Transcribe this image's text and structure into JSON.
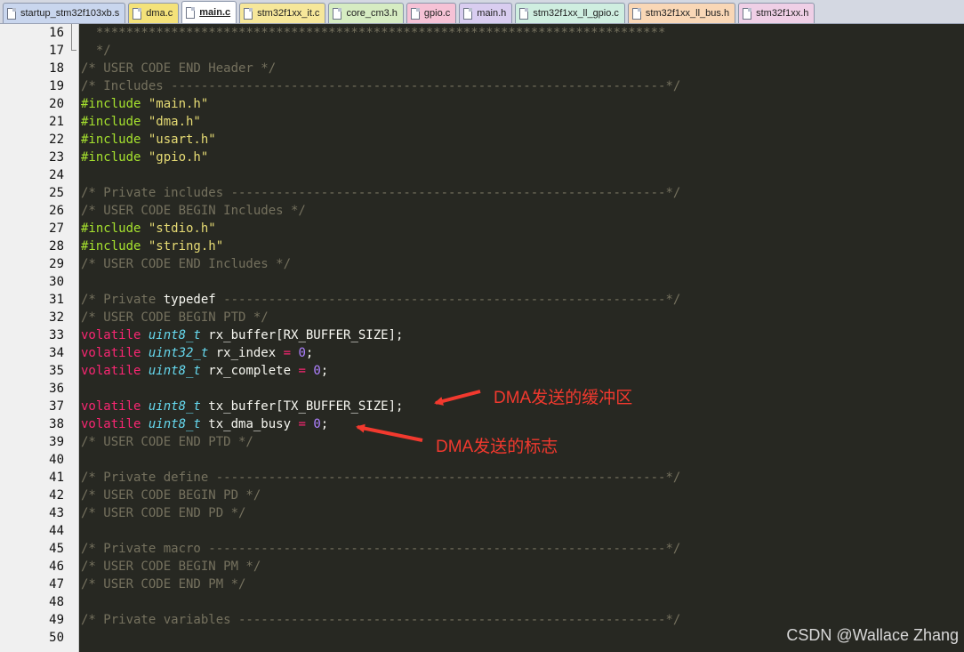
{
  "tabs": [
    {
      "label": "startup_stm32f103xb.s",
      "color": "#c9d6ee"
    },
    {
      "label": "dma.c",
      "color": "#f4e27a"
    },
    {
      "label": "main.c",
      "color": "#ffffff",
      "active": true
    },
    {
      "label": "stm32f1xx_it.c",
      "color": "#f6e79a"
    },
    {
      "label": "core_cm3.h",
      "color": "#d6ecc2"
    },
    {
      "label": "gpio.c",
      "color": "#f6c2d6"
    },
    {
      "label": "main.h",
      "color": "#d9cdf0"
    },
    {
      "label": "stm32f1xx_ll_gpio.c",
      "color": "#cfeee0"
    },
    {
      "label": "stm32f1xx_ll_bus.h",
      "color": "#f9d7b6"
    },
    {
      "label": "stm32f1xx.h",
      "color": "#efcfe6"
    }
  ],
  "code": [
    {
      "n": "16",
      "t": [
        [
          "cm",
          "  ****************************************************************************"
        ]
      ]
    },
    {
      "n": "17",
      "t": [
        [
          "cm",
          "  */"
        ]
      ]
    },
    {
      "n": "18",
      "t": [
        [
          "cm",
          "/* USER CODE END Header */"
        ]
      ]
    },
    {
      "n": "19",
      "t": [
        [
          "cm",
          "/* Includes ------------------------------------------------------------------*/"
        ]
      ]
    },
    {
      "n": "20",
      "t": [
        [
          "pp",
          "#include "
        ],
        [
          "str",
          "\"main.h\""
        ]
      ]
    },
    {
      "n": "21",
      "t": [
        [
          "pp",
          "#include "
        ],
        [
          "str",
          "\"dma.h\""
        ]
      ]
    },
    {
      "n": "22",
      "t": [
        [
          "pp",
          "#include "
        ],
        [
          "str",
          "\"usart.h\""
        ]
      ]
    },
    {
      "n": "23",
      "t": [
        [
          "pp",
          "#include "
        ],
        [
          "str",
          "\"gpio.h\""
        ]
      ]
    },
    {
      "n": "24",
      "t": []
    },
    {
      "n": "25",
      "t": [
        [
          "cm",
          "/* Private includes ----------------------------------------------------------*/"
        ]
      ]
    },
    {
      "n": "26",
      "t": [
        [
          "cm",
          "/* USER CODE BEGIN Includes */"
        ]
      ]
    },
    {
      "n": "27",
      "t": [
        [
          "pp",
          "#include "
        ],
        [
          "str",
          "\"stdio.h\""
        ]
      ]
    },
    {
      "n": "28",
      "t": [
        [
          "pp",
          "#include "
        ],
        [
          "str",
          "\"string.h\""
        ]
      ]
    },
    {
      "n": "29",
      "t": [
        [
          "cm",
          "/* USER CODE END Includes */"
        ]
      ]
    },
    {
      "n": "30",
      "t": []
    },
    {
      "n": "31",
      "t": [
        [
          "cm",
          "/* Private "
        ],
        [
          "pl",
          "typedef"
        ],
        [
          "cm",
          " -----------------------------------------------------------*/"
        ]
      ]
    },
    {
      "n": "32",
      "t": [
        [
          "cm",
          "/* USER CODE BEGIN PTD */"
        ]
      ]
    },
    {
      "n": "33",
      "t": [
        [
          "kw",
          "volatile "
        ],
        [
          "ty",
          "uint8_t"
        ],
        [
          "pl",
          " rx_buffer[RX_BUFFER_SIZE];"
        ]
      ]
    },
    {
      "n": "34",
      "t": [
        [
          "kw",
          "volatile "
        ],
        [
          "ty",
          "uint32_t"
        ],
        [
          "pl",
          " rx_index "
        ],
        [
          "kw",
          "="
        ],
        [
          "pl",
          " "
        ],
        [
          "nm",
          "0"
        ],
        [
          "pl",
          ";"
        ]
      ]
    },
    {
      "n": "35",
      "t": [
        [
          "kw",
          "volatile "
        ],
        [
          "ty",
          "uint8_t"
        ],
        [
          "pl",
          " rx_complete "
        ],
        [
          "kw",
          "="
        ],
        [
          "pl",
          " "
        ],
        [
          "nm",
          "0"
        ],
        [
          "pl",
          ";"
        ]
      ]
    },
    {
      "n": "36",
      "t": []
    },
    {
      "n": "37",
      "t": [
        [
          "kw",
          "volatile "
        ],
        [
          "ty",
          "uint8_t"
        ],
        [
          "pl",
          " tx_buffer[TX_BUFFER_SIZE];"
        ]
      ]
    },
    {
      "n": "38",
      "t": [
        [
          "kw",
          "volatile "
        ],
        [
          "ty",
          "uint8_t"
        ],
        [
          "pl",
          " tx_dma_busy "
        ],
        [
          "kw",
          "="
        ],
        [
          "pl",
          " "
        ],
        [
          "nm",
          "0"
        ],
        [
          "pl",
          ";"
        ]
      ]
    },
    {
      "n": "39",
      "t": [
        [
          "cm",
          "/* USER CODE END PTD */"
        ]
      ]
    },
    {
      "n": "40",
      "t": []
    },
    {
      "n": "41",
      "t": [
        [
          "cm",
          "/* Private define ------------------------------------------------------------*/"
        ]
      ]
    },
    {
      "n": "42",
      "t": [
        [
          "cm",
          "/* USER CODE BEGIN PD */"
        ]
      ]
    },
    {
      "n": "43",
      "t": [
        [
          "cm",
          "/* USER CODE END PD */"
        ]
      ]
    },
    {
      "n": "44",
      "t": []
    },
    {
      "n": "45",
      "t": [
        [
          "cm",
          "/* Private macro -------------------------------------------------------------*/"
        ]
      ]
    },
    {
      "n": "46",
      "t": [
        [
          "cm",
          "/* USER CODE BEGIN PM */"
        ]
      ]
    },
    {
      "n": "47",
      "t": [
        [
          "cm",
          "/* USER CODE END PM */"
        ]
      ]
    },
    {
      "n": "48",
      "t": []
    },
    {
      "n": "49",
      "t": [
        [
          "cm",
          "/* Private variables ---------------------------------------------------------*/"
        ]
      ]
    },
    {
      "n": "50",
      "t": []
    }
  ],
  "annotations": {
    "tx_buffer_note": "DMA发送的缓冲区",
    "tx_busy_note": "DMA发送的标志",
    "arrow_color": "#f2392e"
  },
  "watermark": "CSDN @Wallace Zhang"
}
